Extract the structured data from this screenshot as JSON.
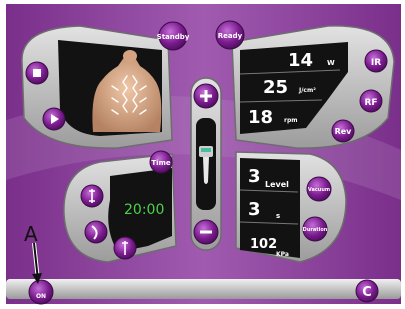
{
  "top_buttons": {
    "standby": "Standby",
    "ready": "Ready"
  },
  "right_upper": {
    "power": {
      "value": "14",
      "unit": "W"
    },
    "fluence": {
      "value": "25",
      "unit": "J/cm²"
    },
    "speed": {
      "value": "18",
      "unit": "rpm"
    },
    "ir_label": "IR",
    "rf_label": "RF",
    "rev_label": "Rev"
  },
  "left_lower": {
    "time_label": "Time",
    "timer": "20:00"
  },
  "right_lower": {
    "level": {
      "value": "3",
      "unit": "Level"
    },
    "seconds": {
      "value": "3",
      "unit": "s"
    },
    "pressure": {
      "value": "102",
      "unit": "KPa"
    },
    "vacuum_label": "Vacuum",
    "duration_label": "Duration"
  },
  "center": {
    "plus": "+",
    "minus": "−"
  },
  "bottom_bar": {
    "on_label": "ON",
    "return_label": "C",
    "annotation": "A"
  },
  "icons": [
    "stop-icon",
    "play-icon",
    "plus-icon",
    "minus-icon",
    "handpiece-icon",
    "return-icon"
  ],
  "colors": {
    "purple": "#7a1f88",
    "digit_green": "#4cd14c",
    "panel": "#c4c4c4"
  }
}
